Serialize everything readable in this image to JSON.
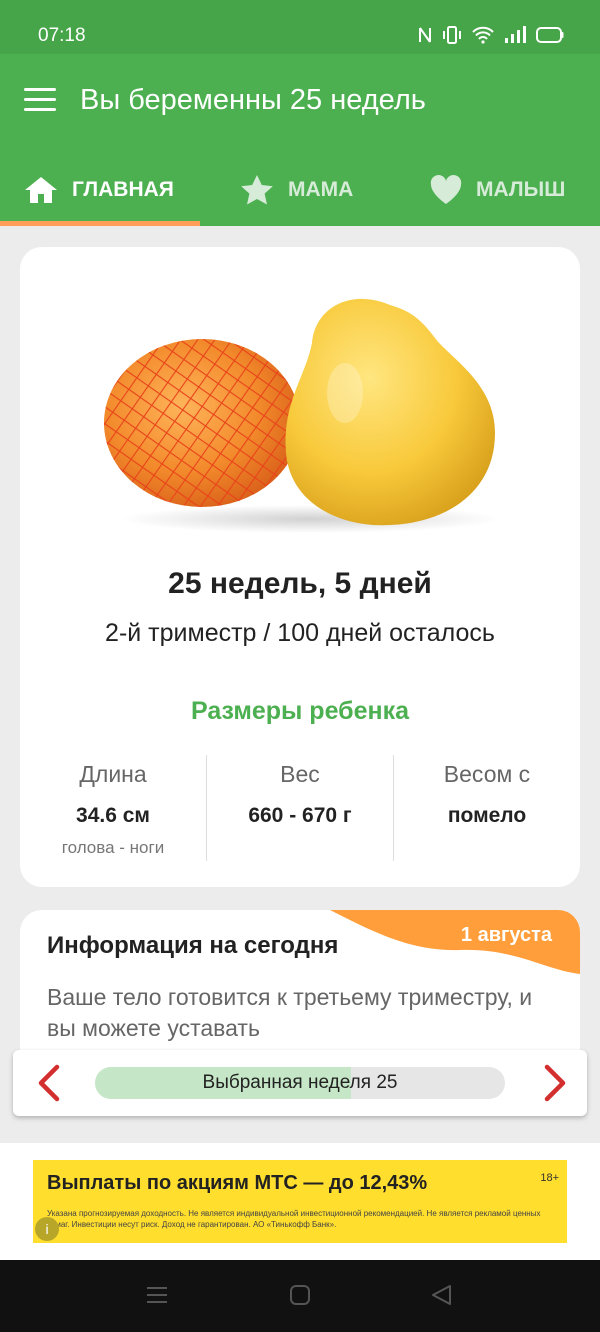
{
  "status_bar": {
    "time": "07:18"
  },
  "app_bar": {
    "title": "Вы беременны 25 недель"
  },
  "tabs": [
    {
      "label": "ГЛАВНАЯ",
      "icon": "home-icon",
      "selected": true
    },
    {
      "label": "МАМА",
      "icon": "star-icon",
      "selected": false
    },
    {
      "label": "МАЛЫШ",
      "icon": "heart-icon",
      "selected": false
    }
  ],
  "summary": {
    "weeks_days": "25 недель, 5 дней",
    "trimester_text": "2-й триместр / 100 дней осталось"
  },
  "baby_sizes": {
    "title": "Размеры ребенка",
    "length": {
      "label": "Длина",
      "value": "34.6 см",
      "note": "голова - ноги"
    },
    "weight": {
      "label": "Вес",
      "value": "660 - 670 г"
    },
    "size_compare": {
      "label": "Весом с",
      "value": "помело"
    }
  },
  "today": {
    "date": "1 августа",
    "heading": "Информация на сегодня",
    "text": "Ваше тело готовится к третьему триместру, и вы можете уставать"
  },
  "week_selector": {
    "label": "Выбранная неделя 25",
    "progress": 0.625
  },
  "ad": {
    "headline": "Выплаты по акциям МТС — до 12,43%",
    "age": "18+",
    "fine_print": "Указана прогнозируемая доходность. Не является индивидуальной инвестиционной рекомендацией. Не является рекламой ценных бумаг. Инвестиции несут риск. Доход не гарантирован. АО «Тинькофф Банк»."
  },
  "colors": {
    "primary_green": "#4caf50",
    "status_green": "#45a548",
    "accent_orange": "#ff9e58",
    "arrow_red": "#d32f2f",
    "ad_yellow": "#ffde2e"
  }
}
